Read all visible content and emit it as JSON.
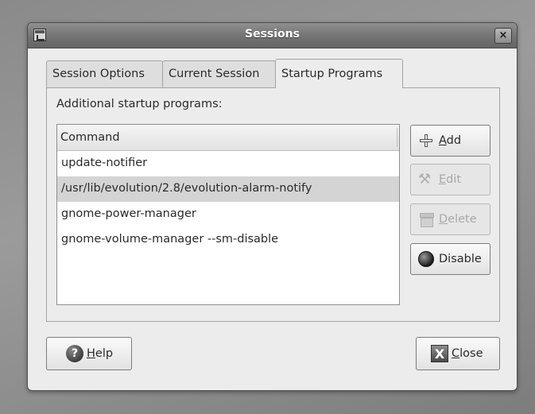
{
  "window": {
    "title": "Sessions",
    "close_glyph": "×"
  },
  "tabs": [
    {
      "label": "Session Options",
      "active": false
    },
    {
      "label": "Current Session",
      "active": false
    },
    {
      "label": "Startup Programs",
      "active": true
    }
  ],
  "startup": {
    "section_label": "Additional startup programs:",
    "column_header": "Command",
    "rows": [
      "update-notifier",
      "/usr/lib/evolution/2.8/evolution-alarm-notify",
      "gnome-power-manager",
      "gnome-volume-manager --sm-disable"
    ],
    "selected_index": 1
  },
  "side_buttons": {
    "add": {
      "mnemonic": "A",
      "rest": "dd",
      "icon": "plus-icon",
      "enabled": true
    },
    "edit": {
      "mnemonic": "E",
      "rest": "dit",
      "icon": "tools-icon",
      "enabled": false
    },
    "delete": {
      "mnemonic": "D",
      "rest": "elete",
      "icon": "trash-icon",
      "enabled": false
    },
    "disable": {
      "label": "Disable",
      "icon": "stop-icon",
      "enabled": true
    }
  },
  "footer": {
    "help": {
      "mnemonic": "H",
      "rest": "elp",
      "icon": "help-icon",
      "glyph": "?"
    },
    "close": {
      "mnemonic": "C",
      "rest": "lose",
      "icon": "close-x-icon",
      "glyph": "X"
    }
  }
}
